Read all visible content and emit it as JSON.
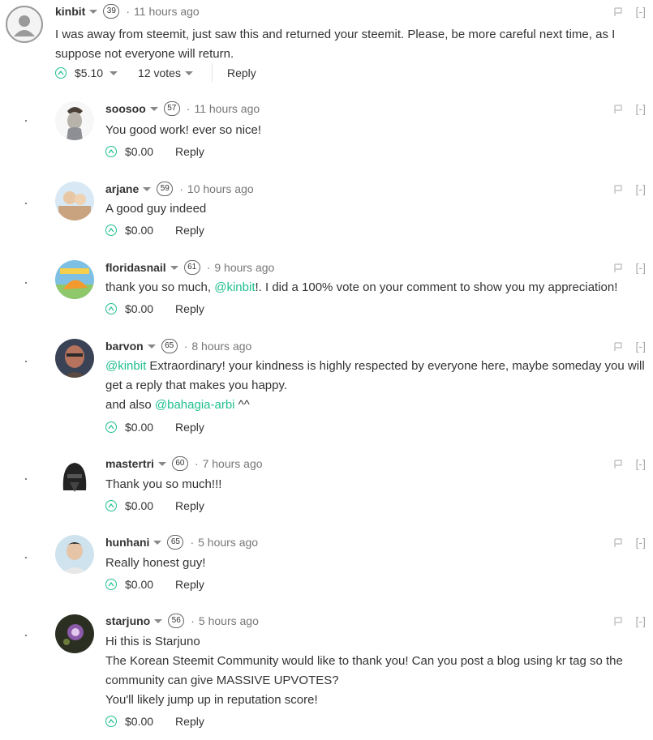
{
  "root": {
    "author": "kinbit",
    "reputation": "39",
    "time": "11 hours ago",
    "body": "I was away from steemit, just saw this and returned your steemit. Please, be more careful next time, as I suppose not everyone will return.",
    "payout": "$5.10",
    "votes": "12 votes",
    "reply_label": "Reply",
    "collapse_label": "[-]"
  },
  "replies": [
    {
      "author": "soosoo",
      "reputation": "57",
      "time": "11 hours ago",
      "lines": [
        "You good work! ever so nice!"
      ],
      "payout": "$0.00",
      "reply_label": "Reply",
      "collapse_label": "[-]"
    },
    {
      "author": "arjane",
      "reputation": "59",
      "time": "10 hours ago",
      "lines": [
        "A good guy indeed"
      ],
      "payout": "$0.00",
      "reply_label": "Reply",
      "collapse_label": "[-]"
    },
    {
      "author": "floridasnail",
      "reputation": "61",
      "time": "9 hours ago",
      "mention": "@kinbit",
      "line_pre": "thank you so much, ",
      "line_post": "!. I did a 100% vote on your comment to show you my appreciation!",
      "payout": "$0.00",
      "reply_label": "Reply",
      "collapse_label": "[-]"
    },
    {
      "author": "barvon",
      "reputation": "65",
      "time": "8 hours ago",
      "mention1": "@kinbit",
      "line1_post": " Extraordinary! your kindness is highly respected by everyone here, maybe someday you will",
      "line2": "get a reply that makes you happy.",
      "line3_pre": "and also ",
      "mention2": "@bahagia-arbi",
      "line3_post": " ^^",
      "payout": "$0.00",
      "reply_label": "Reply",
      "collapse_label": "[-]"
    },
    {
      "author": "mastertri",
      "reputation": "60",
      "time": "7 hours ago",
      "lines": [
        "Thank you so much!!!"
      ],
      "payout": "$0.00",
      "reply_label": "Reply",
      "collapse_label": "[-]"
    },
    {
      "author": "hunhani",
      "reputation": "65",
      "time": "5 hours ago",
      "lines": [
        "Really honest guy!"
      ],
      "payout": "$0.00",
      "reply_label": "Reply",
      "collapse_label": "[-]"
    },
    {
      "author": "starjuno",
      "reputation": "56",
      "time": "5 hours ago",
      "lines": [
        "Hi this is Starjuno",
        "The Korean Steemit Community would like to thank you! Can you post a blog using kr tag so the",
        "community can give MASSIVE UPVOTES?",
        "You'll likely jump up in reputation score!"
      ],
      "payout": "$0.00",
      "reply_label": "Reply",
      "collapse_label": "[-]"
    }
  ],
  "colors": {
    "accent": "#1fbf8f",
    "text": "#333333",
    "muted": "#777777"
  },
  "icons": [
    "default-avatar-icon",
    "caret-down-icon",
    "flag-icon",
    "upvote-icon"
  ]
}
